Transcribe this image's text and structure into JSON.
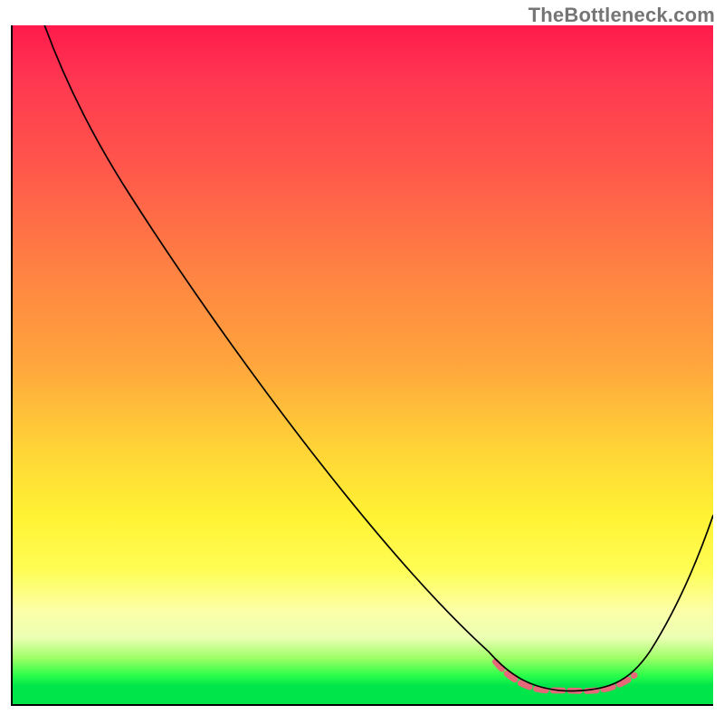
{
  "watermark": "TheBottleneck.com",
  "chart_data": {
    "type": "line",
    "title": "",
    "xlabel": "",
    "ylabel": "",
    "xlim": [
      0,
      100
    ],
    "ylim": [
      0,
      100
    ],
    "grid": false,
    "legend": false,
    "background_gradient": {
      "direction": "vertical",
      "stops": [
        {
          "pos": 0.0,
          "color": "#ff1a4b"
        },
        {
          "pos": 0.22,
          "color": "#ff5a4a"
        },
        {
          "pos": 0.5,
          "color": "#ffa63c"
        },
        {
          "pos": 0.72,
          "color": "#fff233"
        },
        {
          "pos": 0.86,
          "color": "#fcffa7"
        },
        {
          "pos": 0.93,
          "color": "#9dff66"
        },
        {
          "pos": 0.97,
          "color": "#00e64a"
        },
        {
          "pos": 1.0,
          "color": "#00e64a"
        }
      ]
    },
    "series": [
      {
        "name": "bottleneck-curve",
        "color": "#000000",
        "style": "solid",
        "x": [
          5,
          10,
          17,
          30,
          45,
          60,
          68,
          74,
          79,
          85,
          89,
          93,
          97,
          100
        ],
        "y": [
          100,
          91,
          75,
          54,
          35,
          18,
          8,
          4,
          2,
          2,
          4,
          8,
          18,
          28
        ]
      },
      {
        "name": "optimal-range-highlight",
        "color": "#e6697a",
        "style": "dashed",
        "x": [
          69,
          72,
          76,
          80,
          84,
          87,
          89
        ],
        "y": [
          7,
          4,
          2,
          2,
          2,
          3,
          5
        ]
      }
    ],
    "annotations": []
  }
}
